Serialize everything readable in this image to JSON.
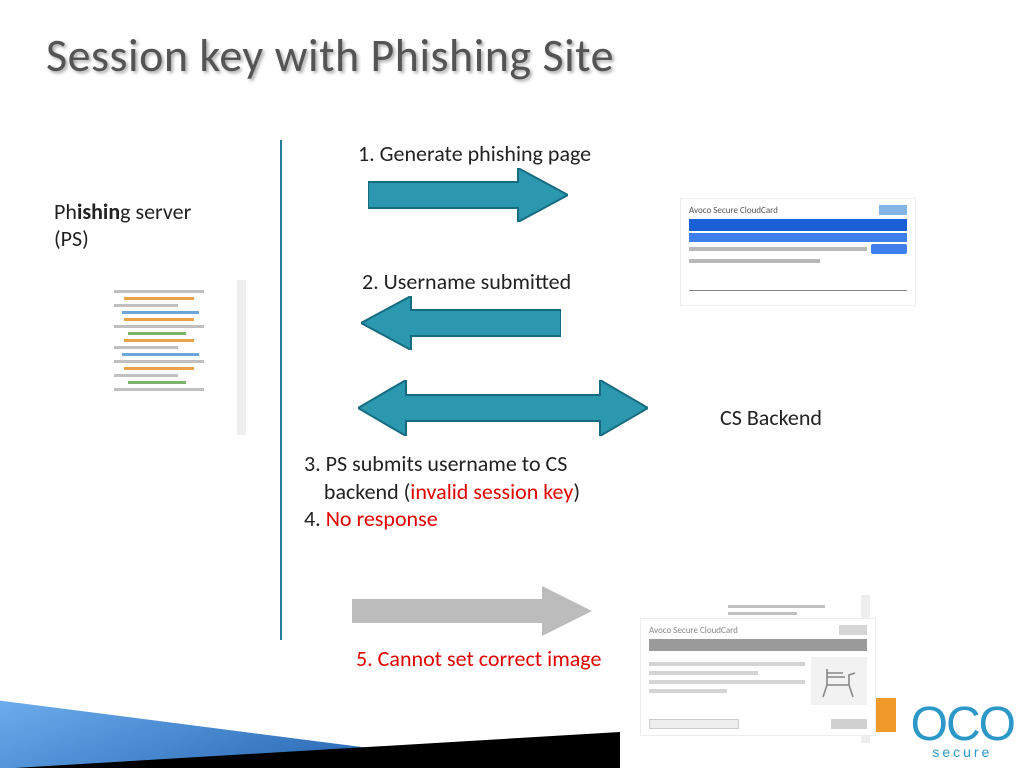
{
  "title": "Session key with Phishing Site",
  "ps_label": {
    "pre": "Ph",
    "bold": "ishin",
    "post": "g server\n(PS)"
  },
  "csb_label": "CS Backend",
  "steps": {
    "s1": "1. Generate phishing page",
    "s2": "2. Username submitted",
    "s3_pre": "3. PS submits username to CS\n    backend (",
    "s3_red": "invalid session key",
    "s3_post": ")",
    "s4_label": "4. ",
    "s4_red": "No response",
    "s5": "5. Cannot set correct image"
  },
  "logo": {
    "big": "OCO",
    "sub": "secure"
  },
  "cloudcard_title": "Avoco Secure CloudCard"
}
